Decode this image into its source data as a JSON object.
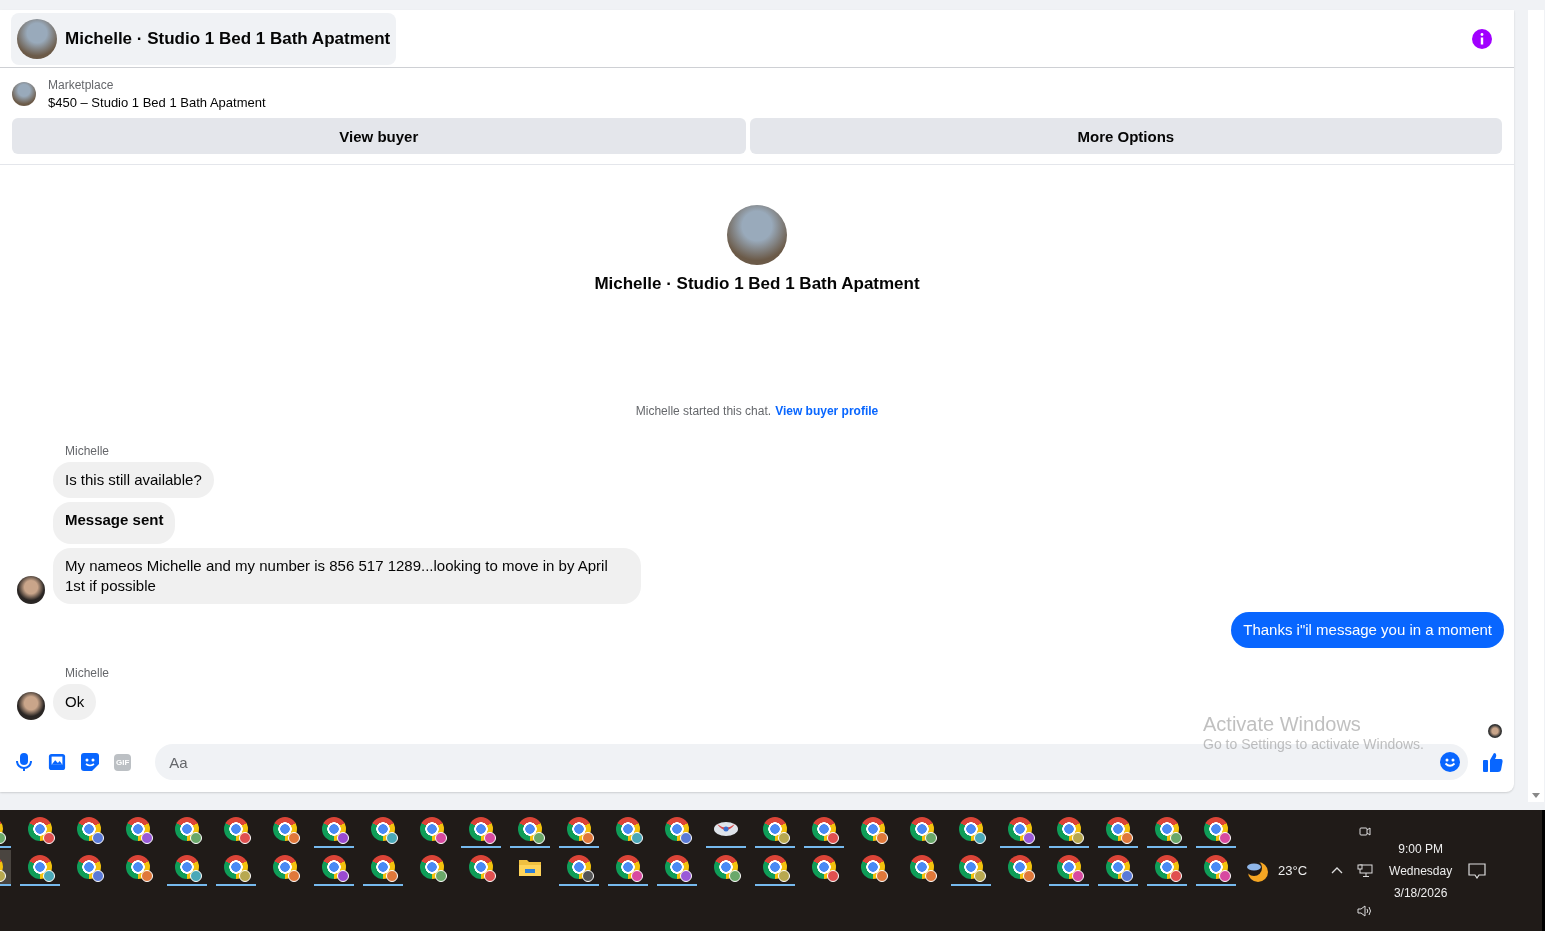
{
  "chat_header": {
    "title": "Michelle · Studio 1 Bed 1 Bath Apatment"
  },
  "listing": {
    "source": "Marketplace",
    "title": "$450 – Studio 1 Bed 1 Bath Apatment"
  },
  "actions": [
    "View buyer",
    "More Options"
  ],
  "intro": {
    "title": "Michelle · Studio 1 Bed 1 Bath Apatment",
    "notice": "Michelle started this chat.",
    "link": "View buyer profile"
  },
  "messages": [
    {
      "kind": "sender",
      "text": "Michelle"
    },
    {
      "kind": "incoming",
      "text": "Is this still available?",
      "avatar": false
    },
    {
      "kind": "status",
      "text": "Message sent"
    },
    {
      "kind": "incoming",
      "text": "My nameos Michelle and my number is 856 517 1289...looking to move in by April 1st if possible",
      "avatar": true
    },
    {
      "kind": "outgoing",
      "text": "Thanks i\"il message you in a moment"
    },
    {
      "kind": "sender",
      "text": "Michelle"
    },
    {
      "kind": "incoming",
      "text": "Ok",
      "avatar": true
    }
  ],
  "composer": {
    "gif_label": "GIF",
    "placeholder": "Aa"
  },
  "watermark": {
    "title": "Activate Windows",
    "subtitle": "Go to Settings to activate Windows."
  },
  "taskbar": {
    "rows": [
      [
        {
          "kind": "browser",
          "color": "#6aa86a",
          "running": true,
          "selected": false
        },
        {
          "kind": "browser",
          "color": "#e05050",
          "running": false,
          "selected": false
        },
        {
          "kind": "browser",
          "color": "#5a7ad8",
          "running": false,
          "selected": false
        },
        {
          "kind": "browser",
          "color": "#9a5ad8",
          "running": false,
          "selected": false
        },
        {
          "kind": "browser",
          "color": "#6aa86a",
          "running": false,
          "selected": false
        },
        {
          "kind": "browser",
          "color": "#e05050",
          "running": false,
          "selected": false
        },
        {
          "kind": "browser",
          "color": "#e0783a",
          "running": false,
          "selected": false
        },
        {
          "kind": "browser",
          "color": "#9a4ad0",
          "running": true,
          "selected": false
        },
        {
          "kind": "browser",
          "color": "#4aa8b8",
          "running": false,
          "selected": false
        },
        {
          "kind": "browser",
          "color": "#d84aa0",
          "running": false,
          "selected": false
        },
        {
          "kind": "browser",
          "color": "#d84aa0",
          "running": true,
          "selected": false
        },
        {
          "kind": "browser",
          "color": "#6aa86a",
          "running": true,
          "selected": false
        },
        {
          "kind": "browser",
          "color": "#e0783a",
          "running": true,
          "selected": false
        },
        {
          "kind": "browser",
          "color": "#4aa8b8",
          "running": false,
          "selected": false
        },
        {
          "kind": "browser",
          "color": "#5a7ad8",
          "running": false,
          "selected": false
        },
        {
          "kind": "app",
          "color": "#d84a4a",
          "running": true,
          "selected": false
        },
        {
          "kind": "browser",
          "color": "#b8a850",
          "running": true,
          "selected": false
        },
        {
          "kind": "browser",
          "color": "#e05050",
          "running": true,
          "selected": false
        },
        {
          "kind": "browser",
          "color": "#e0783a",
          "running": false,
          "selected": false
        },
        {
          "kind": "browser",
          "color": "#6aa86a",
          "running": false,
          "selected": false
        },
        {
          "kind": "browser",
          "color": "#4aa8b8",
          "running": false,
          "selected": false
        },
        {
          "kind": "browser",
          "color": "#9a5ad8",
          "running": true,
          "selected": false
        },
        {
          "kind": "browser",
          "color": "#b8a850",
          "running": true,
          "selected": false
        },
        {
          "kind": "browser",
          "color": "#e0783a",
          "running": true,
          "selected": false
        },
        {
          "kind": "browser",
          "color": "#6aa86a",
          "running": true,
          "selected": false
        },
        {
          "kind": "browser",
          "color": "#d84aa0",
          "running": true,
          "selected": false
        }
      ],
      [
        {
          "kind": "browser",
          "color": "#b8a850",
          "running": true,
          "selected": true
        },
        {
          "kind": "browser",
          "color": "#4aa8b8",
          "running": true,
          "selected": false
        },
        {
          "kind": "browser",
          "color": "#5a7ad8",
          "running": false,
          "selected": false
        },
        {
          "kind": "browser",
          "color": "#e0783a",
          "running": false,
          "selected": false
        },
        {
          "kind": "browser",
          "color": "#4aa8b8",
          "running": true,
          "selected": false
        },
        {
          "kind": "browser",
          "color": "#b8a850",
          "running": true,
          "selected": false
        },
        {
          "kind": "browser",
          "color": "#e0783a",
          "running": false,
          "selected": false
        },
        {
          "kind": "browser",
          "color": "#9a4ad0",
          "running": true,
          "selected": false
        },
        {
          "kind": "browser",
          "color": "#e0783a",
          "running": true,
          "selected": false
        },
        {
          "kind": "browser",
          "color": "#6aa86a",
          "running": false,
          "selected": false
        },
        {
          "kind": "browser",
          "color": "#e05050",
          "running": false,
          "selected": false
        },
        {
          "kind": "folder",
          "color": "#f0c040",
          "running": false,
          "selected": false
        },
        {
          "kind": "browser",
          "color": "#555555",
          "running": true,
          "selected": false
        },
        {
          "kind": "browser",
          "color": "#d84aa0",
          "running": true,
          "selected": false
        },
        {
          "kind": "browser",
          "color": "#9a5ad8",
          "running": true,
          "selected": false
        },
        {
          "kind": "browser",
          "color": "#6aa86a",
          "running": false,
          "selected": false
        },
        {
          "kind": "browser",
          "color": "#b8a850",
          "running": true,
          "selected": false
        },
        {
          "kind": "browser",
          "color": "#e05050",
          "running": false,
          "selected": false
        },
        {
          "kind": "browser",
          "color": "#e0783a",
          "running": false,
          "selected": false
        },
        {
          "kind": "browser",
          "color": "#e0783a",
          "running": false,
          "selected": false
        },
        {
          "kind": "browser",
          "color": "#b8a850",
          "running": true,
          "selected": false
        },
        {
          "kind": "browser",
          "color": "#e0783a",
          "running": false,
          "selected": false
        },
        {
          "kind": "browser",
          "color": "#d84aa0",
          "running": true,
          "selected": false
        },
        {
          "kind": "browser",
          "color": "#5a7ad8",
          "running": true,
          "selected": false
        },
        {
          "kind": "browser",
          "color": "#e05050",
          "running": true,
          "selected": false
        },
        {
          "kind": "browser",
          "color": "#d84aa0",
          "running": true,
          "selected": false
        }
      ]
    ],
    "weather": "23°C",
    "time": "9:00 PM",
    "day": "Wednesday",
    "date": "3/18/2026"
  }
}
